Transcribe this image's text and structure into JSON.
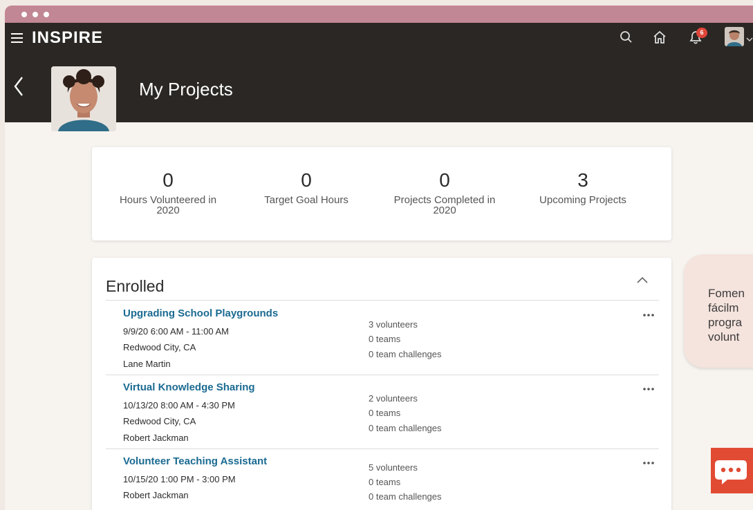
{
  "app": {
    "brand": "INSPIRE",
    "notification_count": "6"
  },
  "header": {
    "page_title": "My Projects"
  },
  "stats": [
    {
      "value": "0",
      "label": "Hours Volunteered in 2020"
    },
    {
      "value": "0",
      "label": "Target Goal Hours"
    },
    {
      "value": "0",
      "label": "Projects Completed in 2020"
    },
    {
      "value": "3",
      "label": "Upcoming Projects"
    }
  ],
  "enrolled": {
    "title": "Enrolled",
    "projects": [
      {
        "title": "Upgrading School Playgrounds",
        "datetime": "9/9/20 6:00 AM  -  11:00 AM",
        "location": "Redwood City, CA",
        "owner": "Lane Martin",
        "volunteers": "3 volunteers",
        "teams": "0 teams",
        "challenges": "0 team challenges"
      },
      {
        "title": "Virtual Knowledge Sharing",
        "datetime": "10/13/20 8:00 AM  -  4:30 PM",
        "location": "Redwood City, CA",
        "owner": "Robert Jackman",
        "volunteers": "2 volunteers",
        "teams": "0 teams",
        "challenges": "0 team challenges"
      },
      {
        "title": "Volunteer Teaching Assistant",
        "datetime": "10/15/20 1:00 PM  -  3:00 PM",
        "location": "",
        "owner": "Robert Jackman",
        "volunteers": "5 volunteers",
        "teams": "0 teams",
        "challenges": "0 team challenges"
      }
    ]
  },
  "promo": {
    "text": "Fomen\nfácilm\nprogra\nvolunt"
  },
  "icons": {
    "menu": "hamburger-icon",
    "search": "search-icon",
    "home": "home-icon",
    "notifications": "notification-icon",
    "back": "back-arrow-icon",
    "collapse": "chevron-up-icon",
    "more": "more-icon",
    "chat": "chat-icon"
  },
  "colors": {
    "titlebar": "#c28794",
    "nav": "#2b2724",
    "link": "#1a6a91",
    "badge": "#e0463a",
    "chat": "#e14b33"
  }
}
